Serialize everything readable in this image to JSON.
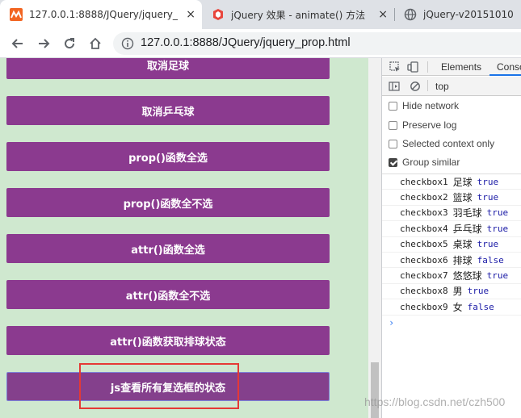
{
  "tabs": [
    {
      "title": "127.0.0.1:8888/JQuery/jquery_",
      "close": "×",
      "active": true
    },
    {
      "title": "jQuery 效果 - animate() 方法",
      "close": "×",
      "active": false
    },
    {
      "title": "jQuery-v20151010",
      "active": false
    }
  ],
  "address": {
    "url": "127.0.0.1:8888/JQuery/jquery_prop.html"
  },
  "page": {
    "buttons": [
      "取消足球",
      "取消乒乓球",
      "prop()函数全选",
      "prop()函数全不选",
      "attr()函数全选",
      "attr()函数全不选",
      "attr()函数获取排球状态",
      "js查看所有复选框的状态"
    ]
  },
  "devtools": {
    "tabs": {
      "elements": "Elements",
      "console": "Conso"
    },
    "context": "top",
    "options": [
      {
        "label": "Hide network",
        "checked": false
      },
      {
        "label": "Preserve log",
        "checked": false
      },
      {
        "label": "Selected context only",
        "checked": false
      },
      {
        "label": "Group similar",
        "checked": true
      }
    ],
    "logs": [
      {
        "id": "checkbox1",
        "name": "足球",
        "value": "true"
      },
      {
        "id": "checkbox2",
        "name": "篮球",
        "value": "true"
      },
      {
        "id": "checkbox3",
        "name": "羽毛球",
        "value": "true"
      },
      {
        "id": "checkbox4",
        "name": "乒乓球",
        "value": "true"
      },
      {
        "id": "checkbox5",
        "name": "桌球",
        "value": "true"
      },
      {
        "id": "checkbox6",
        "name": "排球",
        "value": "false"
      },
      {
        "id": "checkbox7",
        "name": "悠悠球",
        "value": "true"
      },
      {
        "id": "checkbox8",
        "name": "男",
        "value": "true"
      },
      {
        "id": "checkbox9",
        "name": "女",
        "value": "false"
      }
    ],
    "prompt": "›"
  },
  "watermark": "https://blog.csdn.net/czh500",
  "colors": {
    "button": "#8b3a8f",
    "page_bg": "#cfe8cf",
    "highlight": "#e53935",
    "console_value": "#1a1aa6"
  }
}
